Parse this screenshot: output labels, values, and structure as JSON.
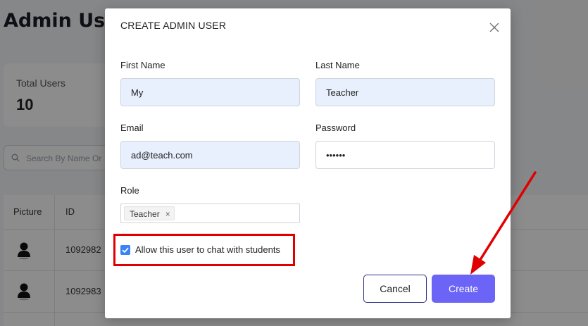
{
  "background": {
    "page_title": "Admin Users",
    "stats": {
      "total_users_label": "Total Users",
      "total_users_value": "10"
    },
    "search_placeholder": "Search By Name Or",
    "table": {
      "headers": [
        "Picture",
        "ID"
      ],
      "rows": [
        {
          "id": "1092982"
        },
        {
          "id": "1092983"
        }
      ]
    }
  },
  "modal": {
    "title": "CREATE ADMIN USER",
    "fields": {
      "first_name_label": "First Name",
      "first_name_value": "My",
      "last_name_label": "Last Name",
      "last_name_value": "Teacher",
      "email_label": "Email",
      "email_value": "ad@teach.com",
      "password_label": "Password",
      "password_value": "••••••",
      "role_label": "Role",
      "role_tag": "Teacher",
      "role_tag_remove": "×"
    },
    "allow_chat_label": "Allow this user to chat with students",
    "allow_chat_checked": true,
    "cancel_label": "Cancel",
    "create_label": "Create"
  },
  "colors": {
    "primary_button": "#6c63f7",
    "checkbox": "#3b82f6",
    "annotation": "#e00000",
    "input_autofill": "#e8effd"
  }
}
